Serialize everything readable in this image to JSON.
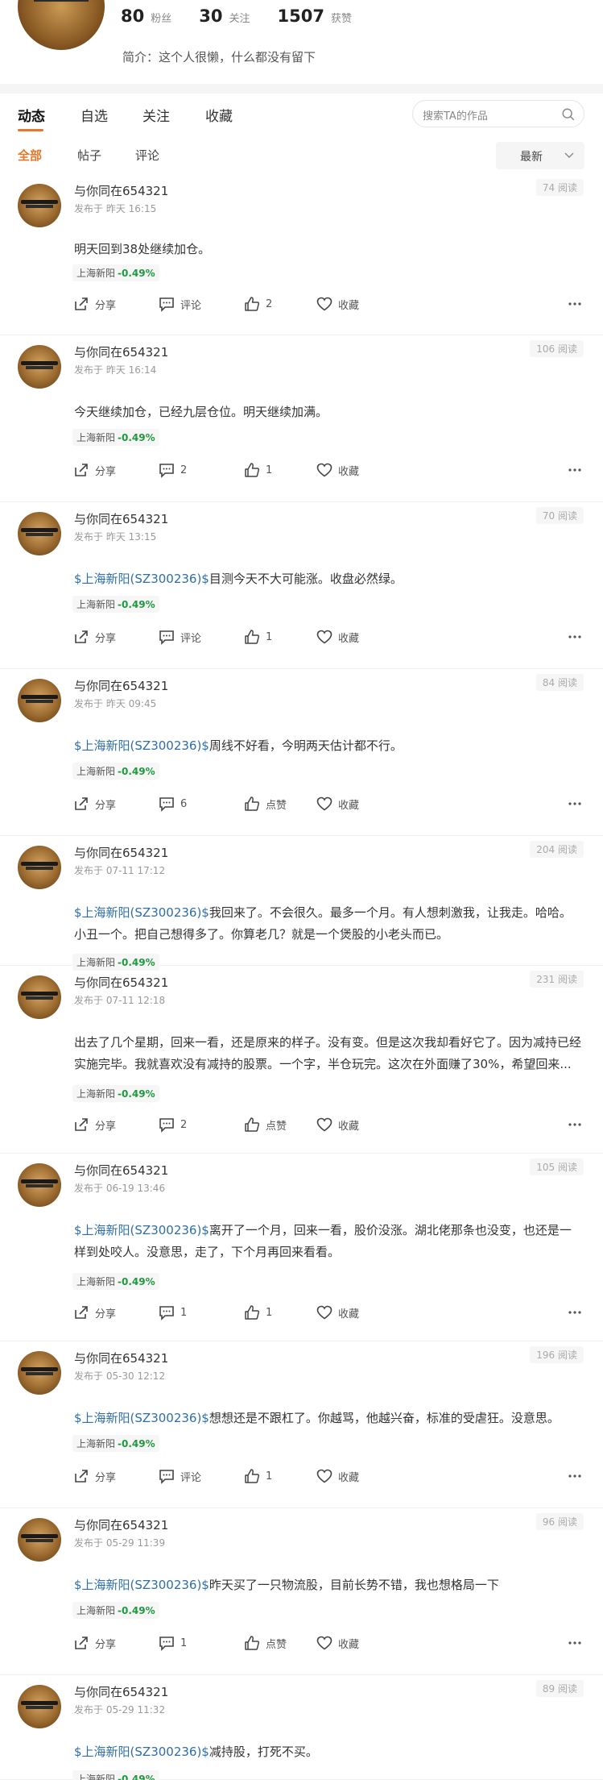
{
  "profile": {
    "fans_count": "80",
    "fans_label": "粉丝",
    "follow_count": "30",
    "follow_label": "关注",
    "likes_count": "1507",
    "likes_label": "获赞",
    "bio": "简介：这个人很懒，什么都没有留下"
  },
  "tabs": [
    "动态",
    "自选",
    "关注",
    "收藏"
  ],
  "search": {
    "placeholder": "搜索TA的作品"
  },
  "subtabs": [
    "全部",
    "帖子",
    "评论"
  ],
  "sort": {
    "label": "最新"
  },
  "actions": {
    "share": "分享",
    "comment": "评论",
    "like": "点赞",
    "collect": "收藏"
  },
  "posts": [
    {
      "name": "与你同在654321",
      "time": "发布于 昨天 16:15",
      "reads": "74 阅读",
      "stock": "",
      "text": "明天回到38处继续加仓。",
      "tag_name": "上海新阳",
      "tag_change": "-0.49%",
      "share": "分享",
      "comment": "评论",
      "like": "2",
      "collect": "收藏"
    },
    {
      "name": "与你同在654321",
      "time": "发布于 昨天 16:14",
      "reads": "106 阅读",
      "stock": "",
      "text": "今天继续加仓，已经九层仓位。明天继续加满。",
      "tag_name": "上海新阳",
      "tag_change": "-0.49%",
      "share": "分享",
      "comment": "2",
      "like": "1",
      "collect": "收藏"
    },
    {
      "name": "与你同在654321",
      "time": "发布于 昨天 13:15",
      "reads": "70 阅读",
      "stock": "$上海新阳(SZ300236)$",
      "text": "目测今天不大可能涨。收盘必然绿。",
      "tag_name": "上海新阳",
      "tag_change": "-0.49%",
      "share": "分享",
      "comment": "评论",
      "like": "1",
      "collect": "收藏"
    },
    {
      "name": "与你同在654321",
      "time": "发布于 昨天 09:45",
      "reads": "84 阅读",
      "stock": "$上海新阳(SZ300236)$",
      "text": "周线不好看，今明两天估计都不行。",
      "tag_name": "上海新阳",
      "tag_change": "-0.49%",
      "share": "分享",
      "comment": "6",
      "like": "点赞",
      "collect": "收藏"
    },
    {
      "name": "与你同在654321",
      "time": "发布于 07-11 17:12",
      "reads": "204 阅读",
      "stock": "$上海新阳(SZ300236)$",
      "text": "我回来了。不会很久。最多一个月。有人想刺激我，让我走。哈哈。小丑一个。把自己想得多了。你算老几？就是一个煲股的小老头而已。",
      "tag_name": "上海新阳",
      "tag_change": "-0.49%",
      "share": "",
      "comment": "",
      "like": "",
      "collect": ""
    },
    {
      "name": "与你同在654321",
      "time": "发布于 07-11 12:18",
      "reads": "231 阅读",
      "stock": "",
      "text": "出去了几个星期，回来一看，还是原来的样子。没有变。但是这次我却看好它了。因为减持已经实施完毕。我就喜欢没有减持的股票。一个字，半仓玩完。这次在外面赚了30%，希望回来...",
      "tag_name": "上海新阳",
      "tag_change": "-0.49%",
      "share": "分享",
      "comment": "2",
      "like": "点赞",
      "collect": "收藏"
    },
    {
      "name": "与你同在654321",
      "time": "发布于 06-19 13:46",
      "reads": "105 阅读",
      "stock": "$上海新阳(SZ300236)$",
      "text": "离开了一个月，回来一看，股价没涨。湖北佬那条也没变，也还是一样到处咬人。没意思，走了，下个月再回来看看。",
      "tag_name": "上海新阳",
      "tag_change": "-0.49%",
      "share": "分享",
      "comment": "1",
      "like": "1",
      "collect": "收藏"
    },
    {
      "name": "与你同在654321",
      "time": "发布于 05-30 12:12",
      "reads": "196 阅读",
      "stock": "$上海新阳(SZ300236)$",
      "text": "想想还是不跟杠了。你越骂，他越兴奋，标准的受虐狂。没意思。",
      "tag_name": "上海新阳",
      "tag_change": "-0.49%",
      "share": "分享",
      "comment": "评论",
      "like": "1",
      "collect": "收藏"
    },
    {
      "name": "与你同在654321",
      "time": "发布于 05-29 11:39",
      "reads": "96 阅读",
      "stock": "$上海新阳(SZ300236)$",
      "text": "昨天买了一只物流股，目前长势不错，我也想格局一下",
      "tag_name": "上海新阳",
      "tag_change": "-0.49%",
      "share": "分享",
      "comment": "1",
      "like": "点赞",
      "collect": "收藏"
    },
    {
      "name": "与你同在654321",
      "time": "发布于 05-29 11:32",
      "reads": "89 阅读",
      "stock": "$上海新阳(SZ300236)$",
      "text": "减持股，打死不买。",
      "tag_name": "上海新阳",
      "tag_change": "-0.49%",
      "share": "",
      "comment": "",
      "like": "",
      "collect": ""
    }
  ]
}
